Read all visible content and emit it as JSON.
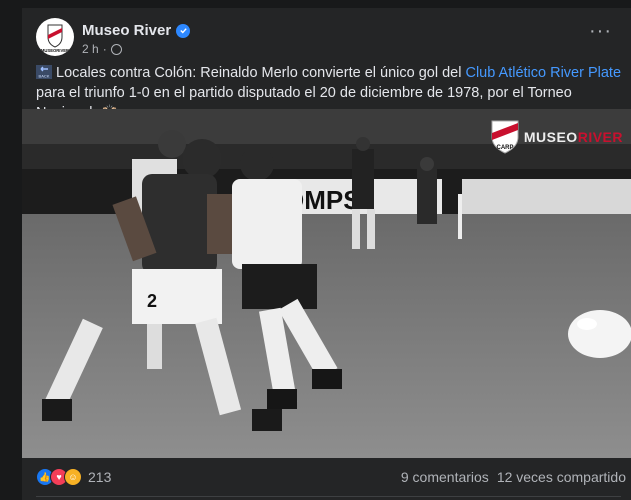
{
  "post": {
    "author": "Museo River",
    "time": "2 h",
    "meta_separator": "·",
    "more_label": "···",
    "text_before_link": "Locales contra Colón: Reinaldo Merlo convierte el único gol del ",
    "link_text": "Club Atlético River Plate",
    "text_after_link": " para el triunfo 1-0 en el partido disputado el 20 de diciembre de 1978, por el Torneo Nacional. 🙌🏻",
    "back_icon_label": "BACK"
  },
  "photo": {
    "watermark_prefix": "MUSEO",
    "watermark_suffix": "RIVER",
    "player_number": "2",
    "billboard_text": "OMPS"
  },
  "avatar_text": "MUSEORIVER",
  "footer": {
    "reaction_count": "213",
    "comments": "9 comentarios",
    "shares": "12 veces compartido"
  },
  "colors": {
    "background": "#18191a",
    "card": "#242526",
    "link": "#4599ff",
    "verified": "#2d88ff",
    "river_red": "#c8102e"
  }
}
